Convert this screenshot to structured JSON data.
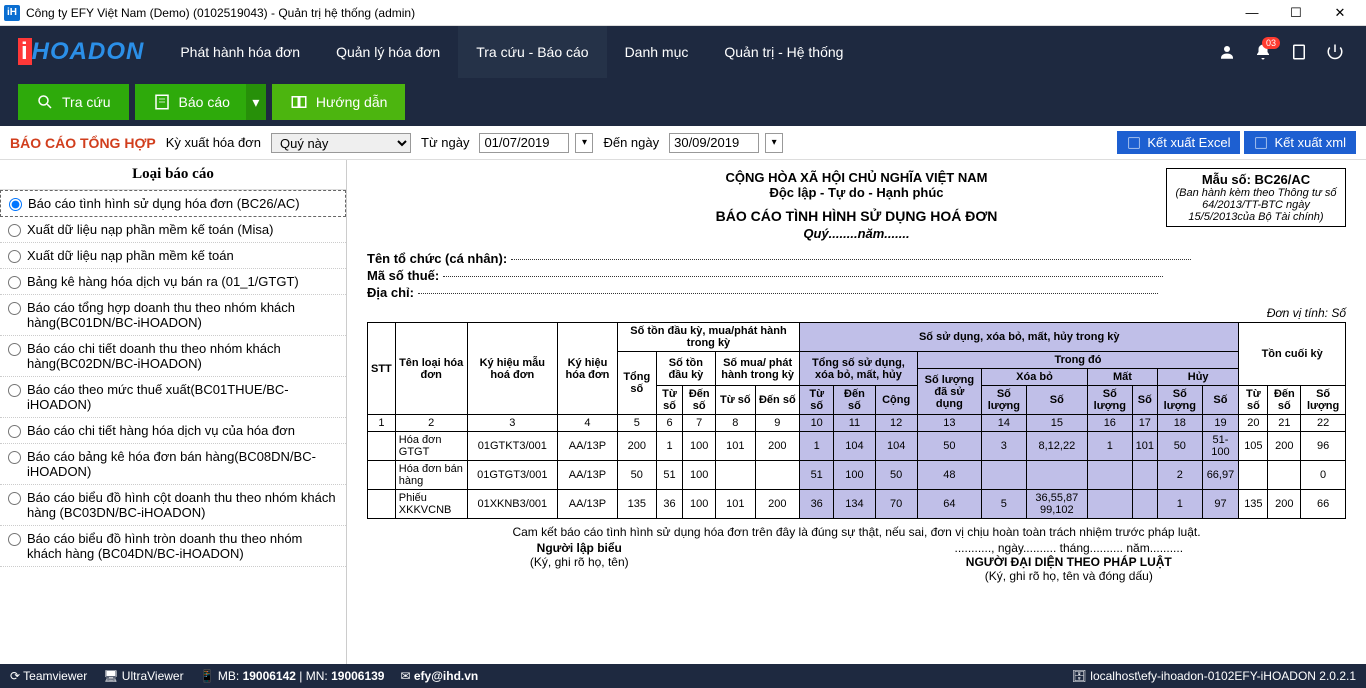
{
  "titlebar": {
    "text": "Công ty EFY Việt Nam (Demo) (0102519043) - Quản trị hệ thống (admin)"
  },
  "nav": {
    "items": [
      "Phát hành hóa đơn",
      "Quản lý hóa đơn",
      "Tra cứu -  Báo cáo",
      "Danh mục",
      "Quản trị - Hệ thống"
    ],
    "active": 2,
    "notif_count": "03"
  },
  "toolbar": {
    "search": "Tra cứu",
    "report": "Báo cáo",
    "guide": "Hướng dẫn"
  },
  "filter": {
    "title": "BÁO CÁO TỔNG HỢP",
    "period_label": "Kỳ xuất hóa đơn",
    "period_value": "Quý này",
    "from_label": "Từ ngày",
    "from_value": "01/07/2019",
    "to_label": "Đến ngày",
    "to_value": "30/09/2019",
    "export_excel": "Kết xuất Excel",
    "export_xml": "Kết xuất xml"
  },
  "sidebar": {
    "title": "Loại báo cáo",
    "items": [
      "Báo cáo tình hình sử dụng hóa đơn (BC26/AC)",
      "Xuất dữ liệu nạp phần mềm kế toán (Misa)",
      "Xuất dữ liệu nạp phần mềm kế toán",
      "Bảng kê hàng hóa dịch vụ bán ra (01_1/GTGT)",
      "Báo cáo tổng hợp doanh thu theo nhóm khách hàng(BC01DN/BC-iHOADON)",
      "Báo cáo chi tiết doanh thu theo nhóm khách hàng(BC02DN/BC-iHOADON)",
      "Báo cáo theo mức thuế xuất(BC01THUE/BC-iHOADON)",
      "Báo cáo chi tiết hàng hóa dịch vụ của hóa đơn",
      "Báo cáo bảng kê hóa đơn bán hàng(BC08DN/BC-iHOADON)",
      "Báo cáo biểu đồ hình cột doanh thu theo nhóm khách hàng (BC03DN/BC-iHOADON)",
      "Báo cáo biểu đồ hình tròn doanh thu theo nhóm khách hàng (BC04DN/BC-iHOADON)"
    ],
    "selected": 0
  },
  "report": {
    "form_code": "Mẫu số: BC26/AC",
    "form_note": "(Ban hành kèm theo Thông tư số 64/2013/TT-BTC  ngày 15/5/2013của Bộ Tài chính)",
    "nation": "CỘNG HÒA XÃ HỘI CHỦ NGHĨA VIỆT NAM",
    "motto": "Độc lập - Tự do - Hạnh phúc",
    "title": "BÁO CÁO TÌNH HÌNH SỬ DỤNG HOÁ ĐƠN",
    "quarter": "Quý........năm.......",
    "org_label": "Tên tổ chức (cá nhân):",
    "tax_label": "Mã số thuế:",
    "addr_label": "Địa chỉ:",
    "unit": "Đơn vị tính: Số",
    "headers": {
      "stt": "STT",
      "type": "Tên loại hóa đơn",
      "model": "Ký hiệu mẫu hoá đơn",
      "serial": "Ký hiệu hóa đơn",
      "opening": "Số tồn đầu kỳ, mua/phát hành trong kỳ",
      "usage": "Số sử dụng, xóa bỏ, mất, hủy trong kỳ",
      "closing": "Tồn cuối kỳ",
      "total": "Tổng số",
      "open_bal": "Số tồn đầu kỳ",
      "issued": "Số mua/ phát hành trong kỳ",
      "total_use": "Tổng số sử dụng, xóa bỏ, mất, hủy",
      "detail": "Trong đó",
      "from": "Từ số",
      "to": "Đến số",
      "sum": "Cộng",
      "used": "Số lượng đã sử dụng",
      "cancel": "Xóa bỏ",
      "lost": "Mất",
      "destroy": "Hủy",
      "qty": "Số lượng",
      "num": "Số"
    },
    "colnums": [
      "1",
      "2",
      "3",
      "4",
      "5",
      "6",
      "7",
      "8",
      "9",
      "10",
      "11",
      "12",
      "13",
      "14",
      "15",
      "16",
      "17",
      "18",
      "19",
      "20",
      "21",
      "22"
    ],
    "rows": [
      {
        "type": "Hóa đơn GTGT",
        "model": "01GTKT3/001",
        "serial": "AA/13P",
        "c5": "200",
        "c6": "1",
        "c7": "100",
        "c8": "101",
        "c9": "200",
        "c10": "1",
        "c11": "104",
        "c12": "104",
        "c13": "50",
        "c14": "3",
        "c15": "8,12,22",
        "c16": "1",
        "c17": "101",
        "c18": "50",
        "c19": "51-100",
        "c20": "105",
        "c21": "200",
        "c22": "96"
      },
      {
        "type": "Hóa đơn bán hàng",
        "model": "01GTGT3/001",
        "serial": "AA/13P",
        "c5": "50",
        "c6": "51",
        "c7": "100",
        "c8": "",
        "c9": "",
        "c10": "51",
        "c11": "100",
        "c12": "50",
        "c13": "48",
        "c14": "",
        "c15": "",
        "c16": "",
        "c17": "",
        "c18": "2",
        "c19": "66,97",
        "c20": "",
        "c21": "",
        "c22": "0"
      },
      {
        "type": "Phiếu XKKVCNB",
        "model": "01XKNB3/001",
        "serial": "AA/13P",
        "c5": "135",
        "c6": "36",
        "c7": "100",
        "c8": "101",
        "c9": "200",
        "c10": "36",
        "c11": "134",
        "c12": "70",
        "c13": "64",
        "c14": "5",
        "c15": "36,55,87 99,102",
        "c16": "",
        "c17": "",
        "c18": "1",
        "c19": "97",
        "c20": "135",
        "c21": "200",
        "c22": "66"
      }
    ],
    "commitment": "Cam kết báo cáo tình hình sử dụng hóa đơn trên đây là đúng sự thật, nếu sai, đơn vị chịu hoàn toàn trách nhiệm trước pháp luật.",
    "date_line": "..........., ngày.......... tháng.......... năm..........",
    "preparer": "Người lập biểu",
    "preparer_sub": "(Ký, ghi rõ họ, tên)",
    "rep": "NGƯỜI ĐẠI DIỆN THEO PHÁP LUẬT",
    "rep_sub": "(Ký, ghi rõ họ, tên và đóng dấu)"
  },
  "status": {
    "tv": "Teamviewer",
    "uv": "UltraViewer",
    "mb_lbl": "MB:",
    "mb": "19006142",
    "mn_lbl": "| MN:",
    "mn": "19006139",
    "email": "efy@ihd.vn",
    "db": "localhost\\efy-ihoadon-0102EFY-iHOADON 2.0.2.1"
  }
}
